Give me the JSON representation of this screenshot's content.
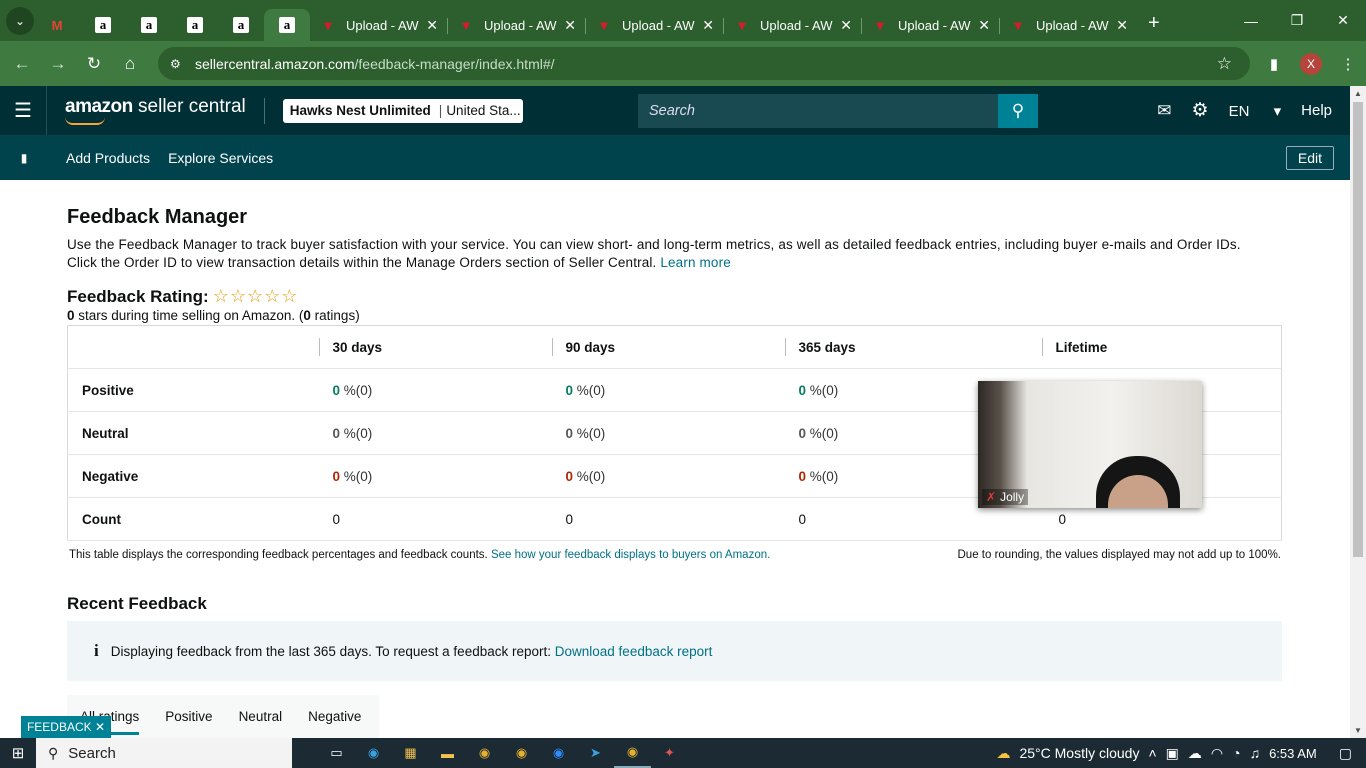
{
  "browser": {
    "tabs": [
      {
        "type": "gmail",
        "label": "M"
      },
      {
        "type": "amazon",
        "label": "a"
      },
      {
        "type": "amazon",
        "label": "a"
      },
      {
        "type": "amazon",
        "label": "a"
      },
      {
        "type": "amazon",
        "label": "a"
      },
      {
        "type": "amazon-active",
        "label": "a"
      },
      {
        "type": "upload",
        "label": "Upload - AW"
      },
      {
        "type": "upload",
        "label": "Upload - AW"
      },
      {
        "type": "upload",
        "label": "Upload - AW"
      },
      {
        "type": "upload",
        "label": "Upload - AW"
      },
      {
        "type": "upload",
        "label": "Upload - AW"
      },
      {
        "type": "upload",
        "label": "Upload - AW"
      }
    ],
    "url_host": "sellercentral.amazon.com",
    "url_path": "/feedback-manager/index.html#/",
    "profile_initial": "X"
  },
  "header": {
    "logo_amazon": "amazon",
    "logo_sc": "seller central",
    "account_name": "Hawks Nest Unlimited",
    "account_market": "United Sta...",
    "search_placeholder": "Search",
    "language": "EN",
    "help": "Help"
  },
  "subnav": {
    "links": [
      "Add Products",
      "Explore Services"
    ],
    "edit": "Edit"
  },
  "page": {
    "title": "Feedback Manager",
    "intro": "Use the Feedback Manager to track buyer satisfaction with your service. You can view short- and long-term metrics, as well as detailed feedback entries, including buyer e-mails and Order IDs. Click the Order ID to view transaction details within the Manage Orders section of Seller Central.",
    "learn_more": "Learn more",
    "rating_label": "Feedback Rating:",
    "stars_value": "0",
    "stars_text_mid": "stars during time selling on Amazon. (",
    "ratings_count": "0",
    "ratings_suffix": "ratings)",
    "table": {
      "headers": [
        "30 days",
        "90 days",
        "365 days",
        "Lifetime"
      ],
      "rows": [
        {
          "label": "Positive",
          "cells": [
            {
              "v": "0",
              "p": "%(0)"
            },
            {
              "v": "0",
              "p": "%(0)"
            },
            {
              "v": "0",
              "p": "%(0)"
            }
          ]
        },
        {
          "label": "Neutral",
          "cells": [
            {
              "v": "0",
              "p": "%(0)"
            },
            {
              "v": "0",
              "p": "%(0)"
            },
            {
              "v": "0",
              "p": "%(0)"
            }
          ]
        },
        {
          "label": "Negative",
          "cells": [
            {
              "v": "0",
              "p": "%(0)"
            },
            {
              "v": "0",
              "p": "%(0)"
            },
            {
              "v": "0",
              "p": "%(0)"
            }
          ]
        },
        {
          "label": "Count",
          "cells": [
            "0",
            "0",
            "0",
            "0"
          ]
        }
      ]
    },
    "note_left": "This table displays the corresponding feedback percentages and feedback counts.",
    "note_link": "See how your feedback displays to buyers on Amazon.",
    "note_right": "Due to rounding, the values displayed may not add up to 100%.",
    "recent_title": "Recent Feedback",
    "info_text": "Displaying feedback from the last 365 days. To request a feedback report:",
    "info_link": "Download feedback report",
    "filter_tabs": [
      "All ratings",
      "Positive",
      "Neutral",
      "Negative"
    ]
  },
  "video": {
    "name": "Jolly"
  },
  "feedback_tag": "FEEDBACK",
  "taskbar": {
    "search": "Search",
    "weather": "25°C  Mostly cloudy",
    "time": "6:53 AM"
  },
  "colors": {
    "browser_dark": "#2c5f2d",
    "amazon_header": "#002f36",
    "subnav": "#00434d",
    "link": "#007185",
    "positive": "#067d62",
    "negative": "#b12704"
  }
}
